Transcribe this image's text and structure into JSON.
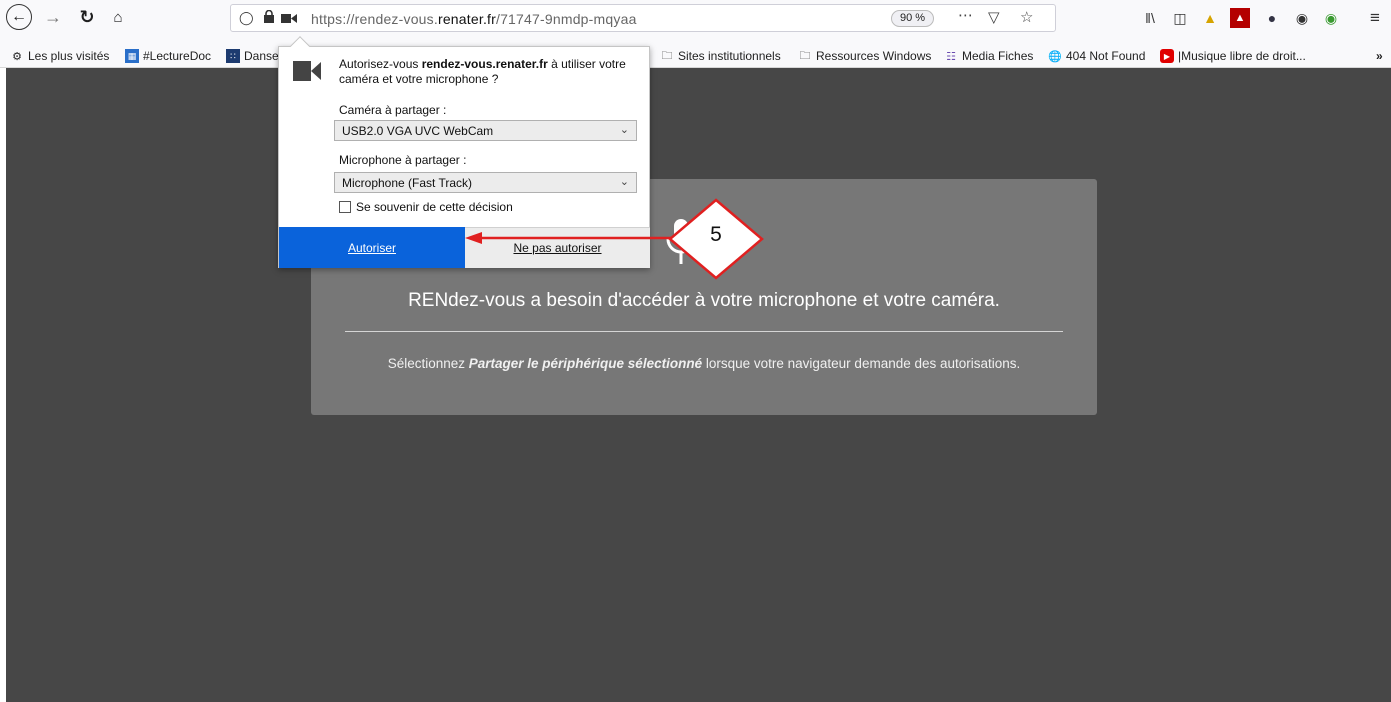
{
  "browser": {
    "url": {
      "prefix": "https://rendez-vous.",
      "domain": "renater.fr",
      "path": "/71747-9nmdp-mqyaa"
    },
    "zoom": "90 %",
    "icons": [
      "back-icon",
      "forward-icon",
      "reload-icon",
      "home-icon",
      "shield-icon",
      "lock-icon",
      "camera-icon",
      "more-icon",
      "pocket-icon",
      "star-icon",
      "library-icon",
      "sidebar-icon",
      "extension-icon",
      "pdf-icon",
      "extension-icon",
      "account-icon",
      "extension-icon",
      "menu-icon"
    ]
  },
  "bookmarks": {
    "items": [
      {
        "label": "Les plus visités",
        "icon": "gear-icon"
      },
      {
        "label": "#LectureDoc",
        "icon": "calendar-icon"
      },
      {
        "label": "Danse",
        "icon": "app-icon"
      },
      {
        "label": "Sites institutionnels",
        "icon": "folder-icon"
      },
      {
        "label": "Ressources Windows",
        "icon": "folder-icon"
      },
      {
        "label": "Media Fiches",
        "icon": "media-icon"
      },
      {
        "label": "404 Not Found",
        "icon": "globe-icon"
      },
      {
        "label": "|Musique libre de droit...",
        "icon": "youtube-icon"
      }
    ],
    "overflow": "»"
  },
  "permission_popup": {
    "message_prefix": "Autorisez-vous ",
    "message_domain": "rendez-vous.renater.fr",
    "message_suffix": " à utiliser votre caméra et votre microphone ?",
    "camera_label": "Caméra à partager :",
    "camera_value": "USB2.0 VGA UVC WebCam",
    "microphone_label": "Microphone à partager :",
    "microphone_value": "Microphone (Fast Track)",
    "remember_label": "Se souvenir de cette décision",
    "allow_label": "Autoriser",
    "deny_label": "Ne pas autoriser"
  },
  "page": {
    "title": "RENdez-vous a besoin d'accéder à votre microphone et votre caméra.",
    "note_prefix": "Sélectionnez ",
    "note_emphasis": "Partager le périphérique sélectionné",
    "note_suffix": " lorsque votre navigateur demande des autorisations."
  },
  "annotation": {
    "step_number": "5",
    "color": "#e02020"
  }
}
